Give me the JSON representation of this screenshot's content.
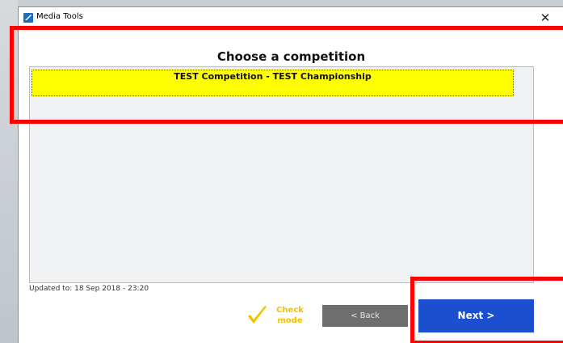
{
  "window": {
    "title": "Media Tools",
    "close_glyph": "✕"
  },
  "dialog": {
    "heading": "Choose a competition",
    "competitions": [
      {
        "label": "TEST Competition - TEST Championship",
        "selected": true,
        "highlight_color": "#ffff00"
      }
    ],
    "updated_text": "Updated to: 18 Sep 2018 - 23:20"
  },
  "footer": {
    "check_mode_label_line1": "Check",
    "check_mode_label_line2": "mode",
    "check_mode_color": "#f2c200",
    "back_label": "< Back",
    "next_label": "Next >",
    "next_color": "#1c4fcf"
  },
  "annotations": {
    "highlight_color": "#ff0000"
  }
}
